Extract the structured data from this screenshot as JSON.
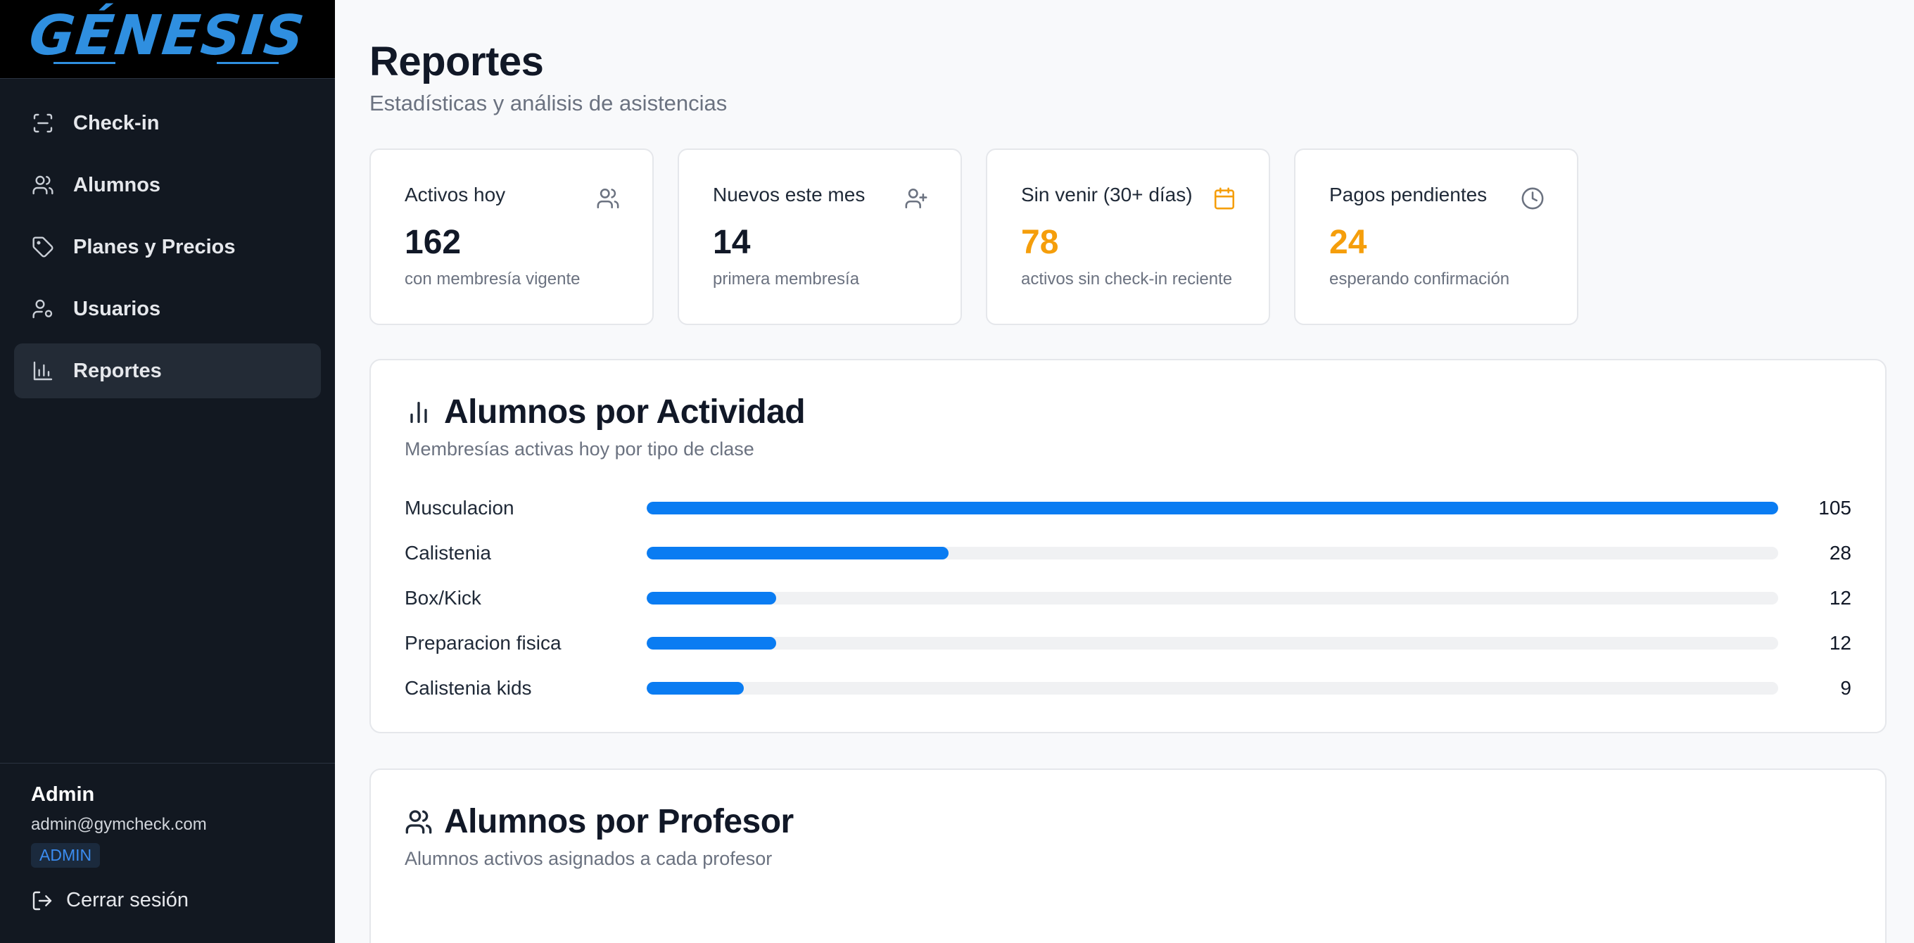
{
  "brand": {
    "logo": "GÉNESIS",
    "accent": "#2f8fe0"
  },
  "sidebar": {
    "items": [
      {
        "label": "Check-in",
        "icon": "scan-icon",
        "active": false
      },
      {
        "label": "Alumnos",
        "icon": "users-icon",
        "active": false
      },
      {
        "label": "Planes y Precios",
        "icon": "tag-icon",
        "active": false
      },
      {
        "label": "Usuarios",
        "icon": "user-cog-icon",
        "active": false
      },
      {
        "label": "Reportes",
        "icon": "bar-chart-icon",
        "active": true
      }
    ],
    "user": {
      "name": "Admin",
      "email": "admin@gymcheck.com",
      "role": "ADMIN"
    },
    "logout": "Cerrar sesión"
  },
  "page": {
    "title": "Reportes",
    "subtitle": "Estadísticas y análisis de asistencias"
  },
  "stats": [
    {
      "label": "Activos hoy",
      "value": "162",
      "desc": "con membresía vigente",
      "icon": "users-icon",
      "highlight": false
    },
    {
      "label": "Nuevos este mes",
      "value": "14",
      "desc": "primera membresía",
      "icon": "user-plus-icon",
      "highlight": false
    },
    {
      "label": "Sin venir (30+ días)",
      "value": "78",
      "desc": "activos sin check-in reciente",
      "icon": "calendar-icon",
      "highlight": true
    },
    {
      "label": "Pagos pendientes",
      "value": "24",
      "desc": "esperando confirmación",
      "icon": "clock-icon",
      "highlight": true
    }
  ],
  "activity": {
    "title": "Alumnos por Actividad",
    "subtitle": "Membresías activas hoy por tipo de clase",
    "bar_color": "#0a7cf2",
    "max": 105,
    "rows": [
      {
        "label": "Musculacion",
        "value": 105
      },
      {
        "label": "Calistenia",
        "value": 28
      },
      {
        "label": "Box/Kick",
        "value": 12
      },
      {
        "label": "Preparacion fisica",
        "value": 12
      },
      {
        "label": "Calistenia kids",
        "value": 9
      }
    ]
  },
  "teacher": {
    "title": "Alumnos por Profesor",
    "subtitle": "Alumnos activos asignados a cada profesor"
  }
}
